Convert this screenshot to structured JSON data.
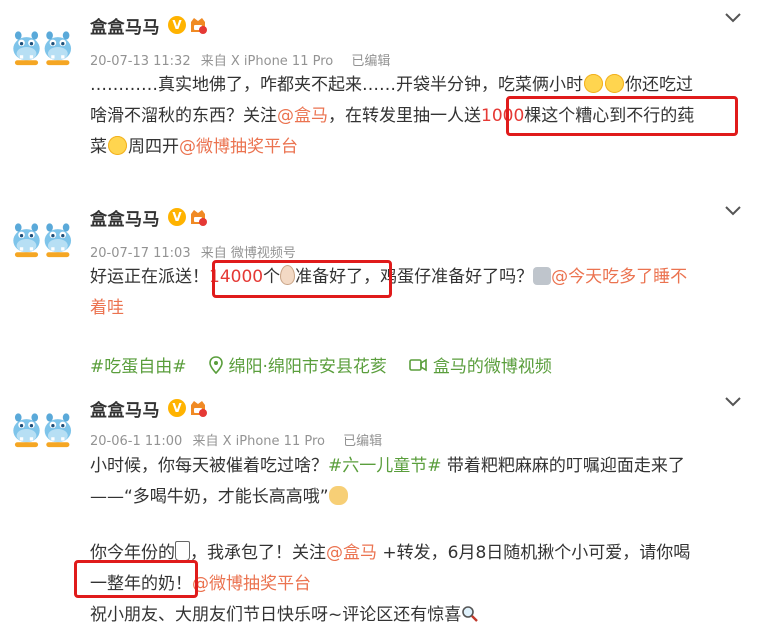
{
  "posts": [
    {
      "author": "盒盒马马",
      "verified_mark": "V",
      "time": "20-07-13 11:32",
      "source": "来自 X iPhone 11 Pro",
      "edited": "已编辑",
      "lines": [
        {
          "a": "…………真实地佛了，咋都夹不起来……开袋半分钟，吃菜俩小时",
          "b": "你还吃过"
        },
        {
          "a": "啥滑不溜秋的东西？关注",
          "mention": "@盒马",
          "b": "，在转发里抽一人送",
          "hl": "1000",
          "c": "棵这个糟心到不行的莼"
        },
        {
          "a": "菜",
          "b": "周四开",
          "mention": "@微博抽奖平台"
        }
      ]
    },
    {
      "author": "盒盒马马",
      "verified_mark": "V",
      "time": "20-07-17 11:03",
      "source": "来自 微博视频号",
      "edited": "",
      "lines": [
        {
          "a": "好运正在派送！",
          "hl": "14000",
          "b": "个",
          "c": "准备好了",
          "d": "，鸡蛋仔准备好了吗？",
          "mention": "@今天吃多了睡不"
        },
        {
          "a": "着哇"
        }
      ],
      "topic": "#吃蛋自由#",
      "location": "绵阳·绵阳市安县花荄",
      "video": "盒马的微博视频"
    },
    {
      "author": "盒盒马马",
      "verified_mark": "V",
      "time": "20-06-1 11:00",
      "source": "来自 X iPhone 11 Pro",
      "edited": "已编辑",
      "lines": [
        {
          "a": "小时候，你每天被催着吃过啥？",
          "topic": "#六一儿童节#",
          "b": " 带着粑粑麻麻的叮嘱迎面走来了"
        },
        {
          "a": "——“多喝牛奶，才能长高高哦”"
        },
        {
          "a": ""
        },
        {
          "a": "你今年份的",
          "b": "，我承包了！关注",
          "mention": "@盒马",
          "c": " +转发，6月8日随机揪个小可爱，请你喝"
        },
        {
          "a": "一整年的奶！",
          "mention": "@微博抽奖平台"
        },
        {
          "a": "祝小朋友、大朋友们节日快乐呀~评论区还有惊喜"
        }
      ]
    }
  ],
  "colors": {
    "link": "#eb7350",
    "topic": "#5a9e3c",
    "highlight_box": "#e01b1b",
    "badge": "#ffb300"
  },
  "icons": [
    "avatar-hippo",
    "verified-icon",
    "member-icon",
    "chevron-down-icon",
    "location-icon",
    "video-icon",
    "smile-emoji",
    "egg-emoji",
    "robot-emoji",
    "dog-emoji",
    "milk-cup-emoji",
    "magnifier-emoji"
  ]
}
